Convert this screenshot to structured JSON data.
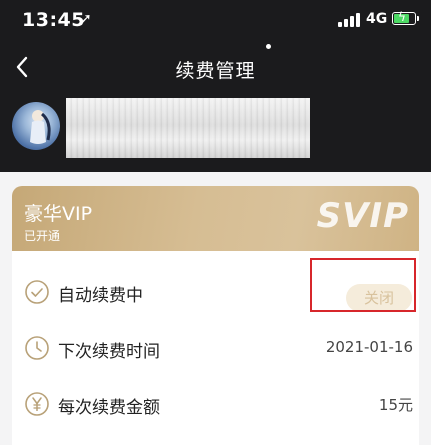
{
  "status_bar": {
    "time": "13:45",
    "location_arrow": "➚",
    "network": "4G"
  },
  "nav": {
    "title": "续费管理",
    "back_icon": "chevron-left-icon"
  },
  "vip": {
    "title": "豪华VIP",
    "subtitle": "已开通",
    "badge": "SVIP"
  },
  "rows": [
    {
      "icon": "check-circle-icon",
      "label": "自动续费中",
      "button_label": "关闭"
    },
    {
      "icon": "clock-icon",
      "label": "下次续费时间",
      "value": "2021-01-16"
    },
    {
      "icon": "yen-coin-icon",
      "label": "每次续费金额",
      "value": "15元"
    }
  ],
  "colors": {
    "dark_bg": "#1b1b1d",
    "gold": "#d0b585",
    "highlight": "#d7262b"
  }
}
